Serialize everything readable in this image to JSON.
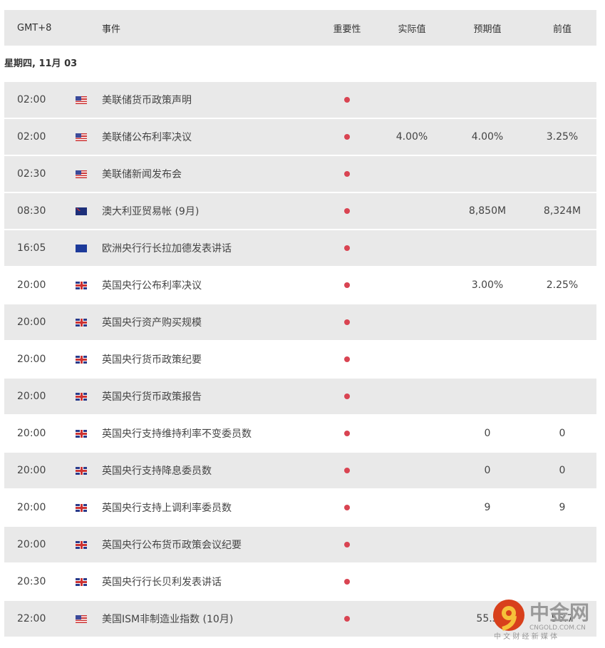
{
  "header": {
    "timezone": "GMT+8",
    "event": "事件",
    "importance": "重要性",
    "actual": "实际值",
    "forecast": "预期值",
    "previous": "前值"
  },
  "date": "星期四, 11月 03",
  "rows": [
    {
      "time": "02:00",
      "flag": "us",
      "event": "美联储货币政策声明",
      "actual": "",
      "forecast": "",
      "previous": ""
    },
    {
      "time": "02:00",
      "flag": "us",
      "event": "美联储公布利率决议",
      "actual": "4.00%",
      "forecast": "4.00%",
      "previous": "3.25%"
    },
    {
      "time": "02:30",
      "flag": "us",
      "event": "美联储新闻发布会",
      "actual": "",
      "forecast": "",
      "previous": ""
    },
    {
      "time": "08:30",
      "flag": "au",
      "event": "澳大利亚贸易帐 (9月)",
      "actual": "",
      "forecast": "8,850M",
      "previous": "8,324M"
    },
    {
      "time": "16:05",
      "flag": "eu",
      "event": "欧洲央行行长拉加德发表讲话",
      "actual": "",
      "forecast": "",
      "previous": ""
    },
    {
      "time": "20:00",
      "flag": "uk",
      "event": "英国央行公布利率决议",
      "actual": "",
      "forecast": "3.00%",
      "previous": "2.25%"
    },
    {
      "time": "20:00",
      "flag": "uk",
      "event": "英国央行资产购买规模",
      "actual": "",
      "forecast": "",
      "previous": ""
    },
    {
      "time": "20:00",
      "flag": "uk",
      "event": "英国央行货币政策纪要",
      "actual": "",
      "forecast": "",
      "previous": ""
    },
    {
      "time": "20:00",
      "flag": "uk",
      "event": "英国央行货币政策报告",
      "actual": "",
      "forecast": "",
      "previous": ""
    },
    {
      "time": "20:00",
      "flag": "uk",
      "event": "英国央行支持维持利率不变委员数",
      "actual": "",
      "forecast": "0",
      "previous": "0"
    },
    {
      "time": "20:00",
      "flag": "uk",
      "event": "英国央行支持降息委员数",
      "actual": "",
      "forecast": "0",
      "previous": "0"
    },
    {
      "time": "20:00",
      "flag": "uk",
      "event": "英国央行支持上调利率委员数",
      "actual": "",
      "forecast": "9",
      "previous": "9"
    },
    {
      "time": "20:00",
      "flag": "uk",
      "event": "英国央行公布货币政策会议纪要",
      "actual": "",
      "forecast": "",
      "previous": ""
    },
    {
      "time": "20:30",
      "flag": "uk",
      "event": "英国央行行长贝利发表讲话",
      "actual": "",
      "forecast": "",
      "previous": ""
    },
    {
      "time": "22:00",
      "flag": "us",
      "event": "美国ISM非制造业指数 (10月)",
      "actual": "",
      "forecast": "55.5",
      "previous": "56.7"
    }
  ],
  "watermark": {
    "name": "中金网",
    "domain": "CNGOLD.COM.CN",
    "tagline": "中 文 财 经 新 媒 体"
  }
}
